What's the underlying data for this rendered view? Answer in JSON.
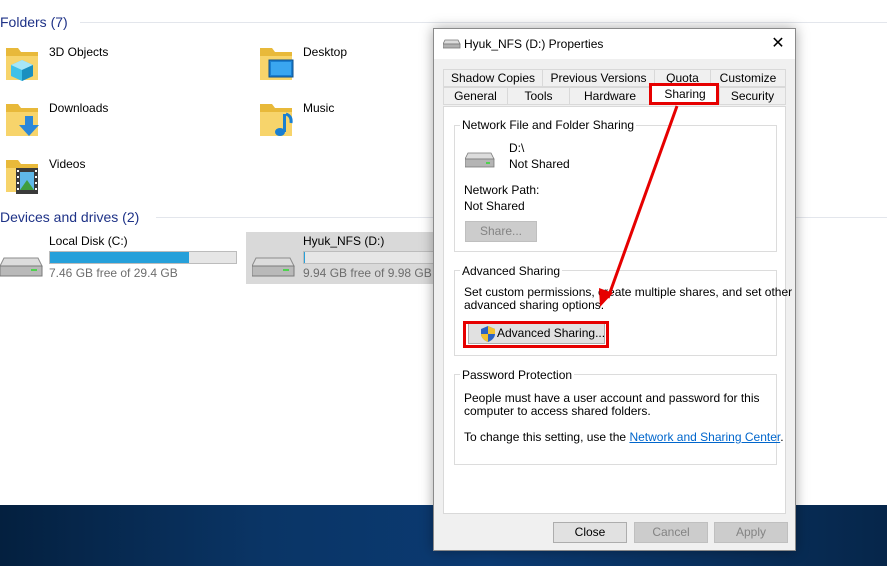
{
  "explorer": {
    "folders_header": "Folders (7)",
    "folders": [
      {
        "label": "3D Objects",
        "icon": "3d-objects-folder-icon"
      },
      {
        "label": "Desktop",
        "icon": "desktop-folder-icon"
      },
      {
        "label": "Downloads",
        "icon": "downloads-folder-icon"
      },
      {
        "label": "Music",
        "icon": "music-folder-icon"
      },
      {
        "label": "Videos",
        "icon": "videos-folder-icon"
      }
    ],
    "devices_header": "Devices and drives (2)",
    "drives": [
      {
        "name": "Local Disk (C:)",
        "free_text": "7.46 GB free of 29.4 GB",
        "used_fraction": 0.746
      },
      {
        "name": "Hyuk_NFS (D:)",
        "free_text": "9.94 GB free of 9.98 GB",
        "used_fraction": 0.004
      }
    ]
  },
  "dialog": {
    "title": "Hyuk_NFS (D:) Properties",
    "close_glyph": "✕",
    "tabs_top": [
      "Shadow Copies",
      "Previous Versions",
      "Quota",
      "Customize"
    ],
    "tabs_bottom": [
      "General",
      "Tools",
      "Hardware",
      "Sharing",
      "Security"
    ],
    "active_tab": "Sharing",
    "network_sharing": {
      "title": "Network File and Folder Sharing",
      "path": "D:\\",
      "status": "Not Shared",
      "network_path_label": "Network Path:",
      "network_path_value": "Not Shared",
      "share_button": "Share..."
    },
    "advanced_sharing": {
      "title": "Advanced Sharing",
      "description_line1": "Set custom permissions, create multiple shares, and set other",
      "description_line2": "advanced sharing options.",
      "button": "Advanced Sharing..."
    },
    "password_protection": {
      "title": "Password Protection",
      "line1": "People must have a user account and password for this",
      "line2": "computer to access shared folders.",
      "line3_prefix": "To change this setting, use the ",
      "link": "Network and Sharing Center",
      "line3_suffix": "."
    },
    "buttons": {
      "close": "Close",
      "cancel": "Cancel",
      "apply": "Apply"
    }
  },
  "colors": {
    "highlight": "#e60000",
    "header_text": "#1e3287",
    "drive_bar": "#26a0da",
    "link": "#0066cc"
  }
}
